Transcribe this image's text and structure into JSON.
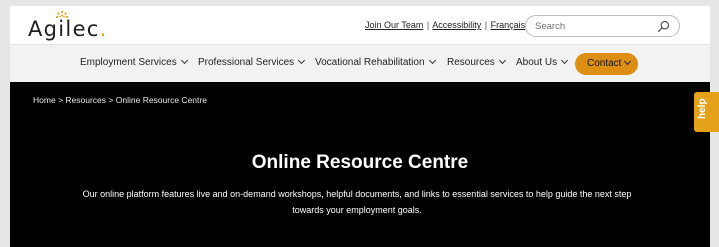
{
  "brand": {
    "name": "Agilec",
    "accent_color": "#e3a21a",
    "logo_icon": "dotted-burst-logo-icon"
  },
  "toplinks": {
    "join": "Join Our Team",
    "separator": "|",
    "accessibility": "Accessibility",
    "language": "Français"
  },
  "search": {
    "placeholder": "Search",
    "icon": "search-icon"
  },
  "nav": {
    "items": [
      {
        "label": "Employment Services"
      },
      {
        "label": "Professional Services"
      },
      {
        "label": "Vocational Rehabilitation"
      },
      {
        "label": "Resources"
      },
      {
        "label": "About Us"
      }
    ],
    "contact": "Contact",
    "contact_color": "#dc8f12"
  },
  "breadcrumb": {
    "home": "Home",
    "separator": ">",
    "resources": "Resources",
    "current": "Online Resource Centre"
  },
  "hero": {
    "title": "Online Resource Centre",
    "description": "Our online platform features live and on-demand workshops, helpful documents, and links to essential services to help guide the next step towards your employment goals.",
    "background": "#000000"
  },
  "help": {
    "label": "help"
  }
}
